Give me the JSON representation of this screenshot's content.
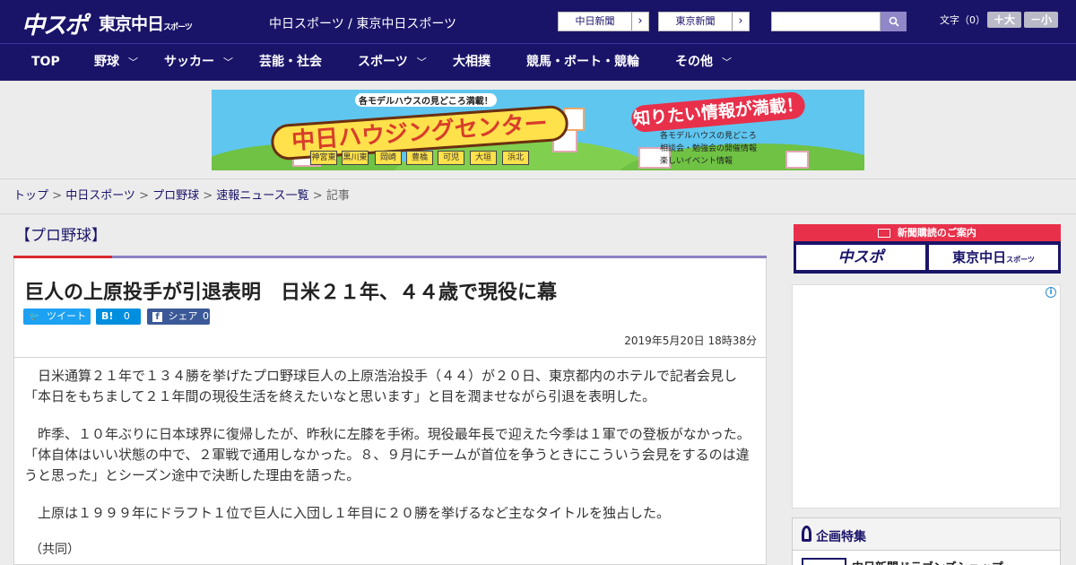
{
  "header": {
    "logo_main": "中スポ",
    "logo_sub": "東京中日",
    "logo_sub_small": "スポーツ",
    "brandline": "中日スポーツ / 東京中日スポーツ",
    "paper_buttons": [
      "中日新聞",
      "東京新聞"
    ],
    "font_size_label": "文字（0）",
    "font_larger": "＋大",
    "font_smaller": "－小"
  },
  "nav": {
    "items": [
      {
        "label": "TOP",
        "dropdown": false
      },
      {
        "label": "野球",
        "dropdown": true
      },
      {
        "label": "サッカー",
        "dropdown": true
      },
      {
        "label": "芸能・社会",
        "dropdown": false
      },
      {
        "label": "スポーツ",
        "dropdown": true
      },
      {
        "label": "大相撲",
        "dropdown": false
      },
      {
        "label": "競馬・ボート・競輪",
        "dropdown": false
      },
      {
        "label": "その他",
        "dropdown": true
      }
    ]
  },
  "banner": {
    "subtitle": "各モデルハウスの見どころ満載！",
    "title": "中日ハウジングセンター",
    "headline": "知りたい情報が満載！",
    "info_lines": [
      "各モデルハウスの見どころ",
      "相談会・勉強会の開催情報",
      "楽しいイベント情報"
    ],
    "locations": [
      "神宮東",
      "黒川東",
      "岡崎",
      "豊橋",
      "可児",
      "大垣",
      "浜北"
    ]
  },
  "breadcrumb": {
    "items": [
      "トップ",
      "中日スポーツ",
      "プロ野球",
      "速報ニュース一覧"
    ],
    "current": "記事"
  },
  "article": {
    "category": "【プロ野球】",
    "headline": "巨人の上原投手が引退表明　日米２１年、４４歳で現役に幕",
    "share": {
      "tweet": "ツイート",
      "hatena_count": "0",
      "share_label": "シェア",
      "share_count": "0"
    },
    "date": "2019年5月20日 18時38分",
    "paragraphs": [
      "日米通算２１年で１３４勝を挙げたプロ野球巨人の上原浩治投手（４４）が２０日、東京都内のホテルで記者会見し「本日をもちまして２１年間の現役生活を終えたいなと思います」と目を潤ませながら引退を表明した。",
      "昨季、１０年ぶりに日本球界に復帰したが、昨秋に左膝を手術。現役最年長で迎えた今季は１軍での登板がなかった。「体自体はいい状態の中で、２軍戦で通用しなかった。８、９月にチームが首位を争うときにこういう会見をするのは違うと思った」とシーズン途中で決断した理由を語った。",
      "上原は１９９９年にドラフト１位で巨人に入団し１年目に２０勝を挙げるなど主なタイトルを独占した。"
    ],
    "credit": "（共同）"
  },
  "sidebar": {
    "subscription_header": "新聞購読のご案内",
    "subscription_buttons": [
      "中スポ",
      "東京中日"
    ],
    "subscription_button_small": "スポーツ",
    "ad_info": "i",
    "feature_title": "企画特集",
    "feature_item": "中日新聞ドラゴンズショップ"
  },
  "colors": {
    "navy": "#1a1469",
    "red": "#e8304a",
    "twitter": "#1da1f2",
    "facebook": "#3b5998"
  }
}
